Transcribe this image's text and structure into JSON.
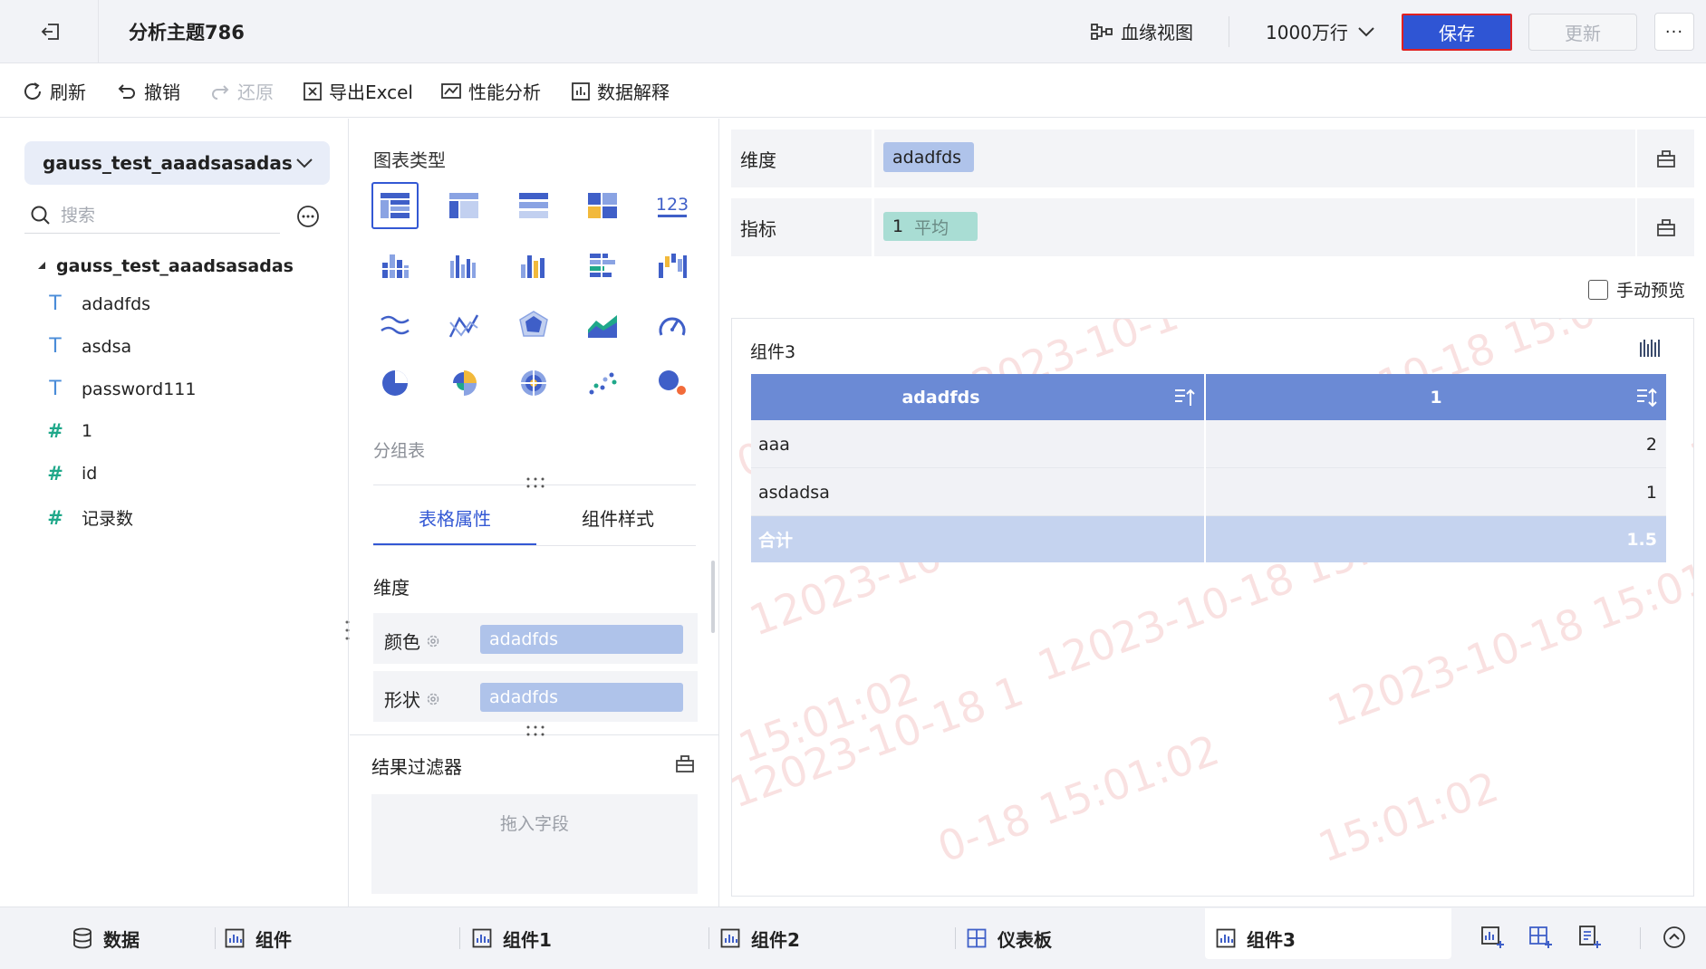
{
  "header": {
    "title": "分析主题786",
    "lineage_label": "血缘视图",
    "rows_limit": "1000万行",
    "save_label": "保存",
    "update_label": "更新",
    "more_label": "···"
  },
  "toolbar": {
    "refresh": "刷新",
    "undo": "撤销",
    "redo": "还原",
    "export": "导出Excel",
    "perf": "性能分析",
    "explain": "数据解释"
  },
  "left": {
    "datasource": "gauss_test_aaadsasadas",
    "search_placeholder": "搜索",
    "tree_root": "gauss_test_aaadsasadas",
    "fields": [
      {
        "name": "adadfds",
        "type": "T"
      },
      {
        "name": "asdsa",
        "type": "T"
      },
      {
        "name": "password111",
        "type": "T"
      },
      {
        "name": "1",
        "type": "#"
      },
      {
        "name": "id",
        "type": "#"
      },
      {
        "name": "记录数",
        "type": "#"
      }
    ]
  },
  "middle": {
    "chart_type_label": "图表类型",
    "chart_sub_label": "分组表",
    "tabs": [
      "表格属性",
      "组件样式"
    ],
    "dim_label": "维度",
    "color_label": "颜色",
    "shape_label": "形状",
    "color_chip": "adadfds",
    "shape_chip": "adadfds",
    "filter_label": "结果过滤器",
    "filter_placeholder": "拖入字段"
  },
  "right": {
    "dim_label": "维度",
    "dim_chip": "adadfds",
    "measure_label": "指标",
    "measure_chip_name": "1",
    "measure_chip_agg": "平均",
    "manual_preview": "手动预览",
    "card_title": "组件3",
    "table": {
      "columns": [
        "adadfds",
        "1"
      ],
      "rows": [
        [
          "aaa",
          "2"
        ],
        [
          "asdadsa",
          "1"
        ]
      ],
      "total": [
        "合计",
        "1.5"
      ]
    },
    "watermark_text": "12023-10-18 15:01:02",
    "watermark_fragments": [
      "12023-10-1",
      "12023-10-18 15:0",
      "02",
      "1",
      "12023-10-18 15:01:02",
      "12023-10-18 15:01:02",
      "12023-10-18 15:01:02",
      "12023-10-18 1",
      "15:01:02",
      "0-18 15:01:02",
      "15:01:02"
    ]
  },
  "bottom": {
    "tabs": [
      "数据",
      "组件",
      "组件1",
      "组件2",
      "仪表板",
      "组件3"
    ]
  },
  "colors": {
    "accent": "#2f55d4",
    "table_header": "#6b8ad5",
    "dim_chip": "#afc3ea",
    "measure_chip": "#a9ddd4",
    "total_row": "#c5d3ef"
  }
}
